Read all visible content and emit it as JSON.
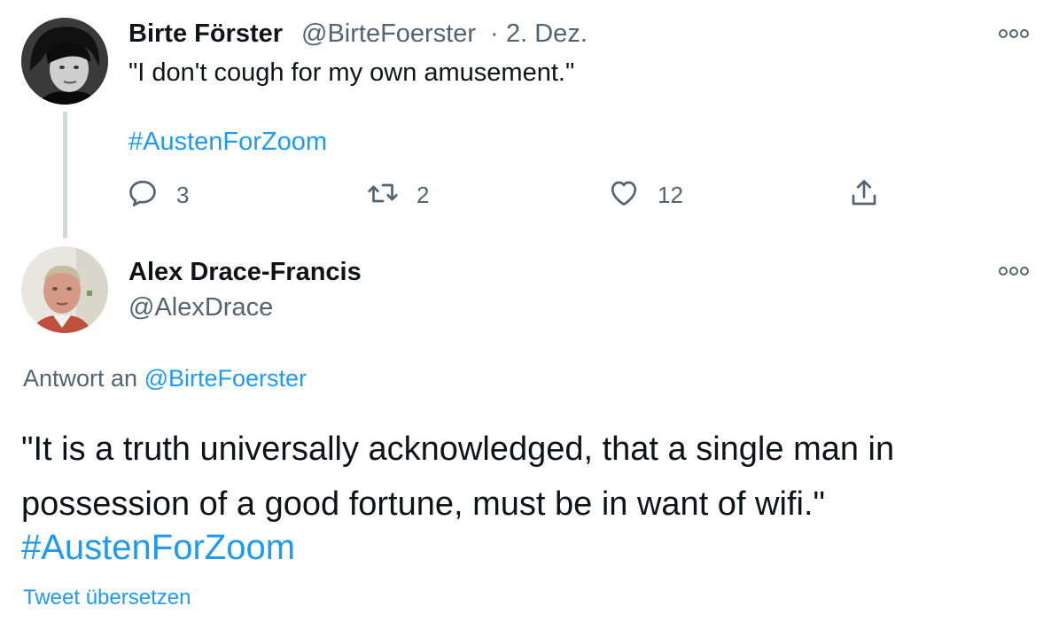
{
  "tweet1": {
    "author_name": "Birte Förster",
    "author_handle": "@BirteFoerster",
    "separator": "·",
    "date": "2. Dez.",
    "text": "\"I don't cough for my own amusement.\"",
    "hashtag": "#AustenForZoom",
    "actions": {
      "replies": "3",
      "retweets": "2",
      "likes": "12"
    },
    "icons": [
      "more-icon",
      "reply-icon",
      "retweet-icon",
      "like-icon",
      "share-icon"
    ]
  },
  "tweet2": {
    "author_name": "Alex Drace-Francis",
    "author_handle": "@AlexDrace",
    "reply_prefix": "Antwort an",
    "reply_to": "@BirteFoerster",
    "text": "\"It is a truth universally acknowledged, that a single man in possession of a good fortune, must be in want of wifi.\"",
    "hashtag": "#AustenForZoom",
    "translate_label": "Tweet übersetzen",
    "icons": [
      "more-icon"
    ]
  },
  "colors": {
    "link": "#1d9bf0",
    "secondary": "#536471",
    "primary_text": "#0f1419",
    "thread_line": "#cfd9de"
  }
}
